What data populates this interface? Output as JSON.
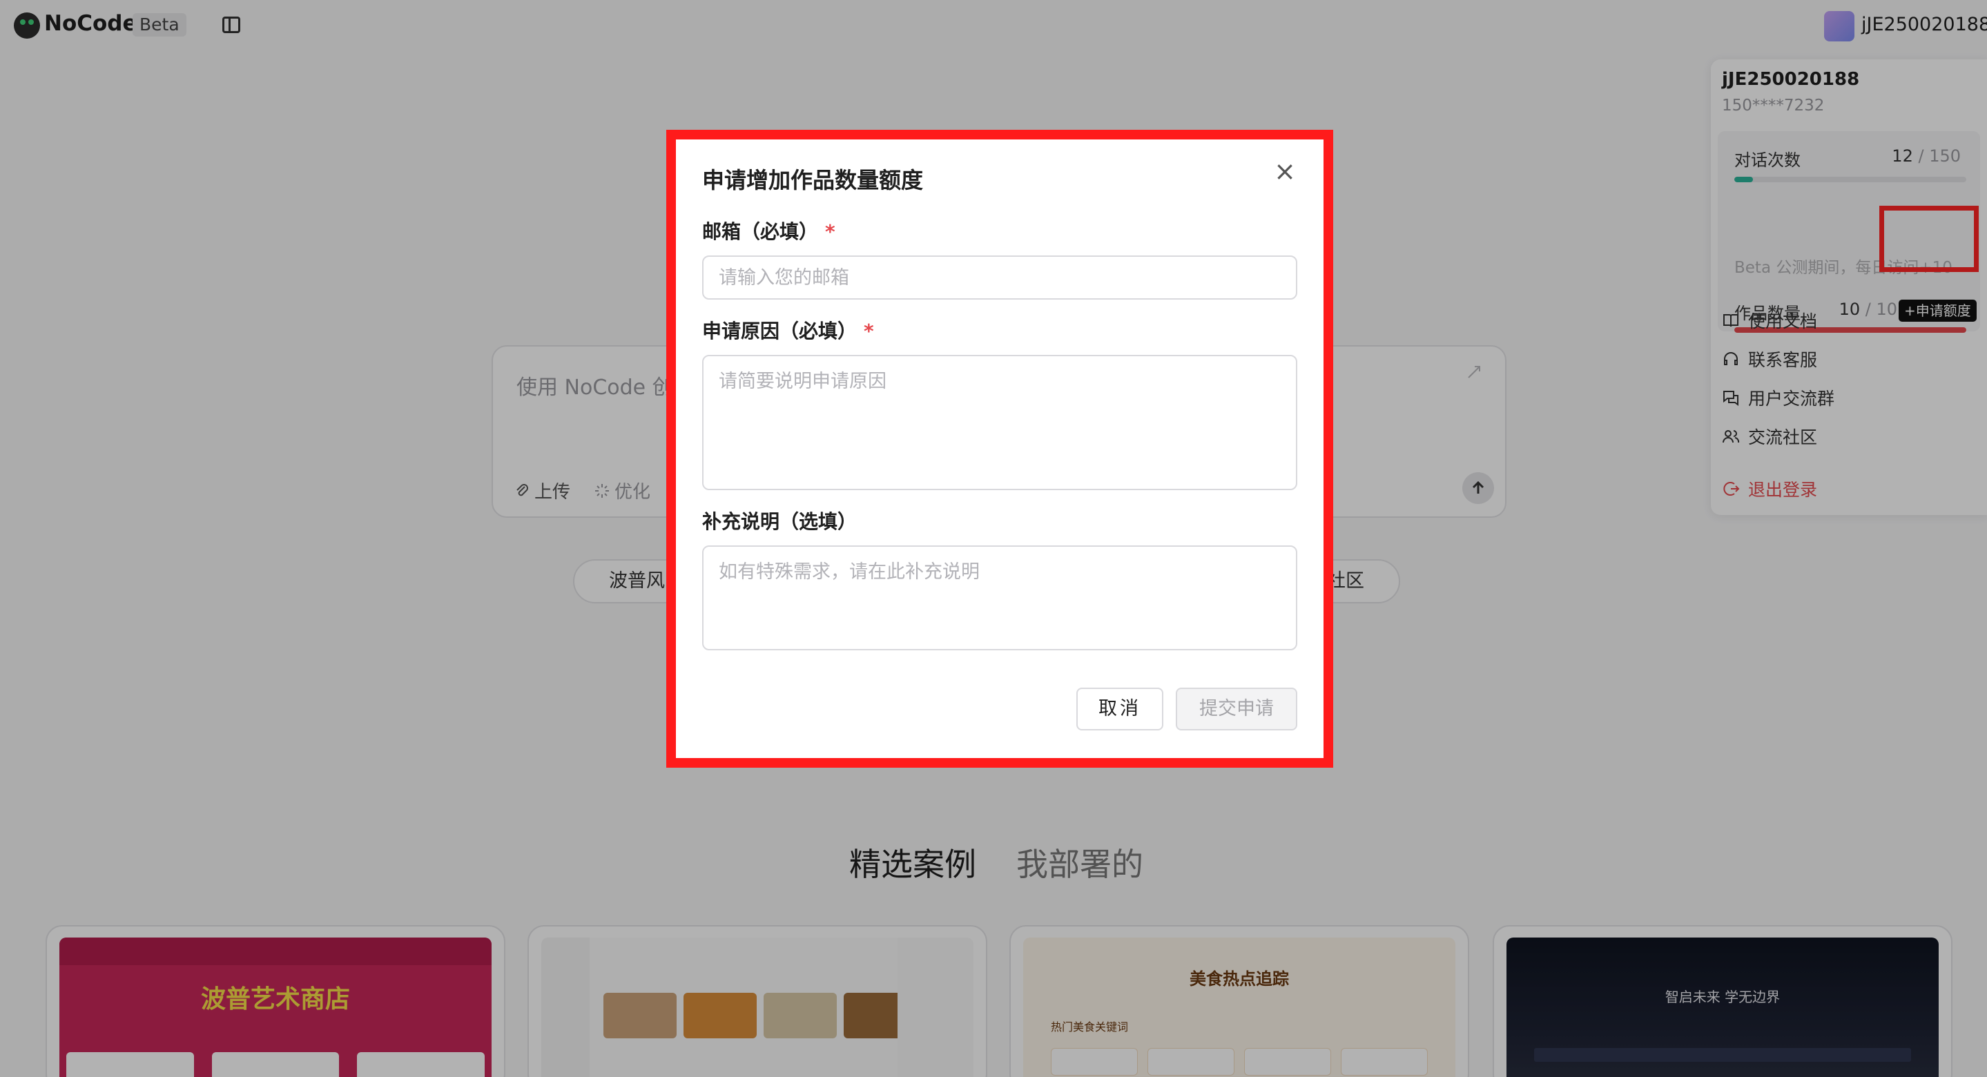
{
  "header": {
    "brand": "NoCode",
    "beta": "Beta",
    "username": "jJE250020188"
  },
  "chat": {
    "placeholder": "使用 NoCode 创",
    "upload_label": "上传",
    "optimize_label": "优化"
  },
  "chips": [
    "波普风",
    "社区"
  ],
  "featured": {
    "tabs": [
      "精选案例",
      "我部署的"
    ],
    "cards": [
      {
        "title": "波普艺术商店"
      },
      {
        "title": ""
      },
      {
        "title": "美食热点追踪",
        "label": "热门美食关键词"
      },
      {
        "title": "智启未来 学无边界"
      }
    ]
  },
  "user_panel": {
    "name": "jJE250020188",
    "phone": "150****7232",
    "chat_count": {
      "label": "对话次数",
      "used": "12",
      "total": "150",
      "progress": 0.08,
      "color": "#2bb39a"
    },
    "note": "Beta 公测期间，每日访问+10",
    "works": {
      "label": "作品数量",
      "used": "10",
      "total": "10",
      "progress": 1.0,
      "color": "#e5484d"
    },
    "apply_button": "+申请额度",
    "menu": [
      {
        "label": "使用文档",
        "icon": "book-icon"
      },
      {
        "label": "联系客服",
        "icon": "headset-icon"
      },
      {
        "label": "用户交流群",
        "icon": "chat-group-icon"
      },
      {
        "label": "交流社区",
        "icon": "users-icon"
      }
    ],
    "logout": "退出登录"
  },
  "modal": {
    "title": "申请增加作品数量额度",
    "email_label": "邮箱（必填）",
    "email_placeholder": "请输入您的邮箱",
    "reason_label": "申请原因（必填）",
    "reason_placeholder": "请简要说明申请原因",
    "extra_label": "补充说明（选填）",
    "extra_placeholder": "如有特殊需求，请在此补充说明",
    "required_mark": "*",
    "cancel": "取消",
    "submit": "提交申请",
    "close_symbol": "×"
  },
  "colors": {
    "highlight": "#ff1b1b",
    "danger": "#e5484d"
  }
}
